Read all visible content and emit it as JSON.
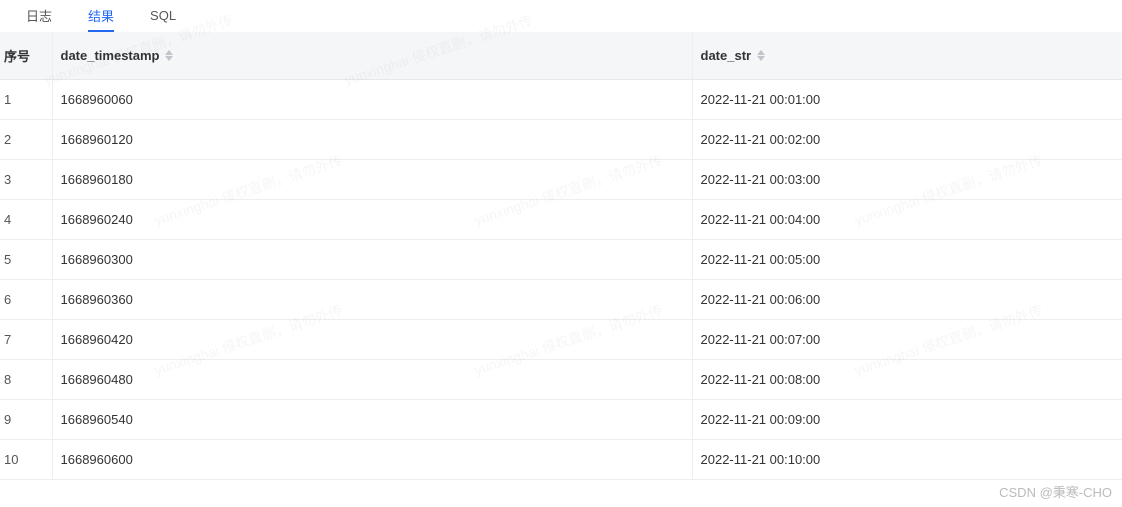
{
  "tabs": {
    "log": "日志",
    "result": "结果",
    "sql": "SQL",
    "active_index": 1
  },
  "columns": {
    "seq": "序号",
    "date_timestamp": "date_timestamp",
    "date_str": "date_str"
  },
  "rows": [
    {
      "seq": "1",
      "date_timestamp": "1668960060",
      "date_str": "2022-11-21 00:01:00"
    },
    {
      "seq": "2",
      "date_timestamp": "1668960120",
      "date_str": "2022-11-21 00:02:00"
    },
    {
      "seq": "3",
      "date_timestamp": "1668960180",
      "date_str": "2022-11-21 00:03:00"
    },
    {
      "seq": "4",
      "date_timestamp": "1668960240",
      "date_str": "2022-11-21 00:04:00"
    },
    {
      "seq": "5",
      "date_timestamp": "1668960300",
      "date_str": "2022-11-21 00:05:00"
    },
    {
      "seq": "6",
      "date_timestamp": "1668960360",
      "date_str": "2022-11-21 00:06:00"
    },
    {
      "seq": "7",
      "date_timestamp": "1668960420",
      "date_str": "2022-11-21 00:07:00"
    },
    {
      "seq": "8",
      "date_timestamp": "1668960480",
      "date_str": "2022-11-21 00:08:00"
    },
    {
      "seq": "9",
      "date_timestamp": "1668960540",
      "date_str": "2022-11-21 00:09:00"
    },
    {
      "seq": "10",
      "date_timestamp": "1668960600",
      "date_str": "2022-11-21 00:10:00"
    }
  ],
  "watermark": "CSDN @秉寒-CHO",
  "faint_watermark": "yunxinghai 侵权直删，请勿外传"
}
